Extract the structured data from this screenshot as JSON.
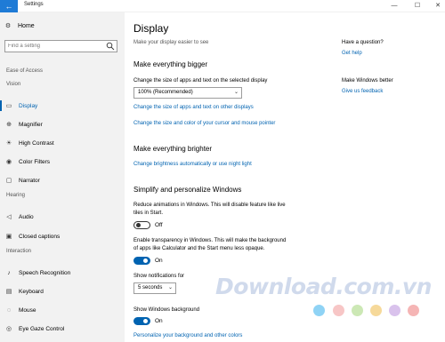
{
  "window": {
    "title": "Settings",
    "back_glyph": "←",
    "minimize_glyph": "—",
    "maximize_glyph": "☐",
    "close_glyph": "✕"
  },
  "sidebar": {
    "home_label": "Home",
    "search_placeholder": "Find a setting",
    "category": "Ease of Access",
    "sections": {
      "vision": "Vision",
      "hearing": "Hearing",
      "interaction": "Interaction"
    },
    "items": [
      {
        "label": "Display",
        "icon": "display-icon",
        "glyph": "▭"
      },
      {
        "label": "Magnifier",
        "icon": "magnifier-icon",
        "glyph": "⊕"
      },
      {
        "label": "High Contrast",
        "icon": "contrast-icon",
        "glyph": "☀"
      },
      {
        "label": "Color Filters",
        "icon": "color-filters-icon",
        "glyph": "◉"
      },
      {
        "label": "Narrator",
        "icon": "narrator-icon",
        "glyph": "▢"
      },
      {
        "label": "Audio",
        "icon": "audio-icon",
        "glyph": "◁"
      },
      {
        "label": "Closed captions",
        "icon": "captions-icon",
        "glyph": "▣"
      },
      {
        "label": "Speech Recognition",
        "icon": "speech-icon",
        "glyph": "♪"
      },
      {
        "label": "Keyboard",
        "icon": "keyboard-icon",
        "glyph": "▤"
      },
      {
        "label": "Mouse",
        "icon": "mouse-icon",
        "glyph": "◌"
      },
      {
        "label": "Eye Gaze Control",
        "icon": "eye-gaze-icon",
        "glyph": "◎"
      }
    ]
  },
  "main": {
    "title": "Display",
    "subtitle": "Make your display easier to see",
    "bigger": {
      "heading": "Make everything bigger",
      "label": "Change the size of apps and text on the selected display",
      "dropdown_value": "100% (Recommended)",
      "link1": "Change the size of apps and text on other displays",
      "link2": "Change the size and color of your cursor and mouse pointer"
    },
    "brighter": {
      "heading": "Make everything brighter",
      "link": "Change brightness automatically or use night light"
    },
    "simplify": {
      "heading": "Simplify and personalize Windows",
      "animations_line1": "Reduce animations in Windows.  This will disable feature like live",
      "animations_line2": "tiles in Start.",
      "animations_state": "Off",
      "transparency_line1": "Enable transparency in Windows.  This will make the background",
      "transparency_line2": "of apps like Calculator and the Start menu less opaque.",
      "transparency_state": "On",
      "notifications_label": "Show notifications for",
      "notifications_value": "5 seconds",
      "background_label": "Show Windows background",
      "background_state": "On",
      "personalize_link": "Personalize your background and other colors"
    }
  },
  "aside": {
    "question_heading": "Have a question?",
    "help_link": "Get help",
    "better_heading": "Make Windows better",
    "feedback_link": "Give us feedback"
  },
  "watermark": {
    "text": "Download.com.vn",
    "dot_colors": [
      "#8fd3f5",
      "#f7c6c6",
      "#cce8b5",
      "#f6d99a",
      "#d9c2ec",
      "#f5b5b5"
    ]
  },
  "colors": {
    "accent": "#0063b1",
    "titlebar_back": "#1f7bd6",
    "sidebar_bg": "#f2f2f2"
  }
}
